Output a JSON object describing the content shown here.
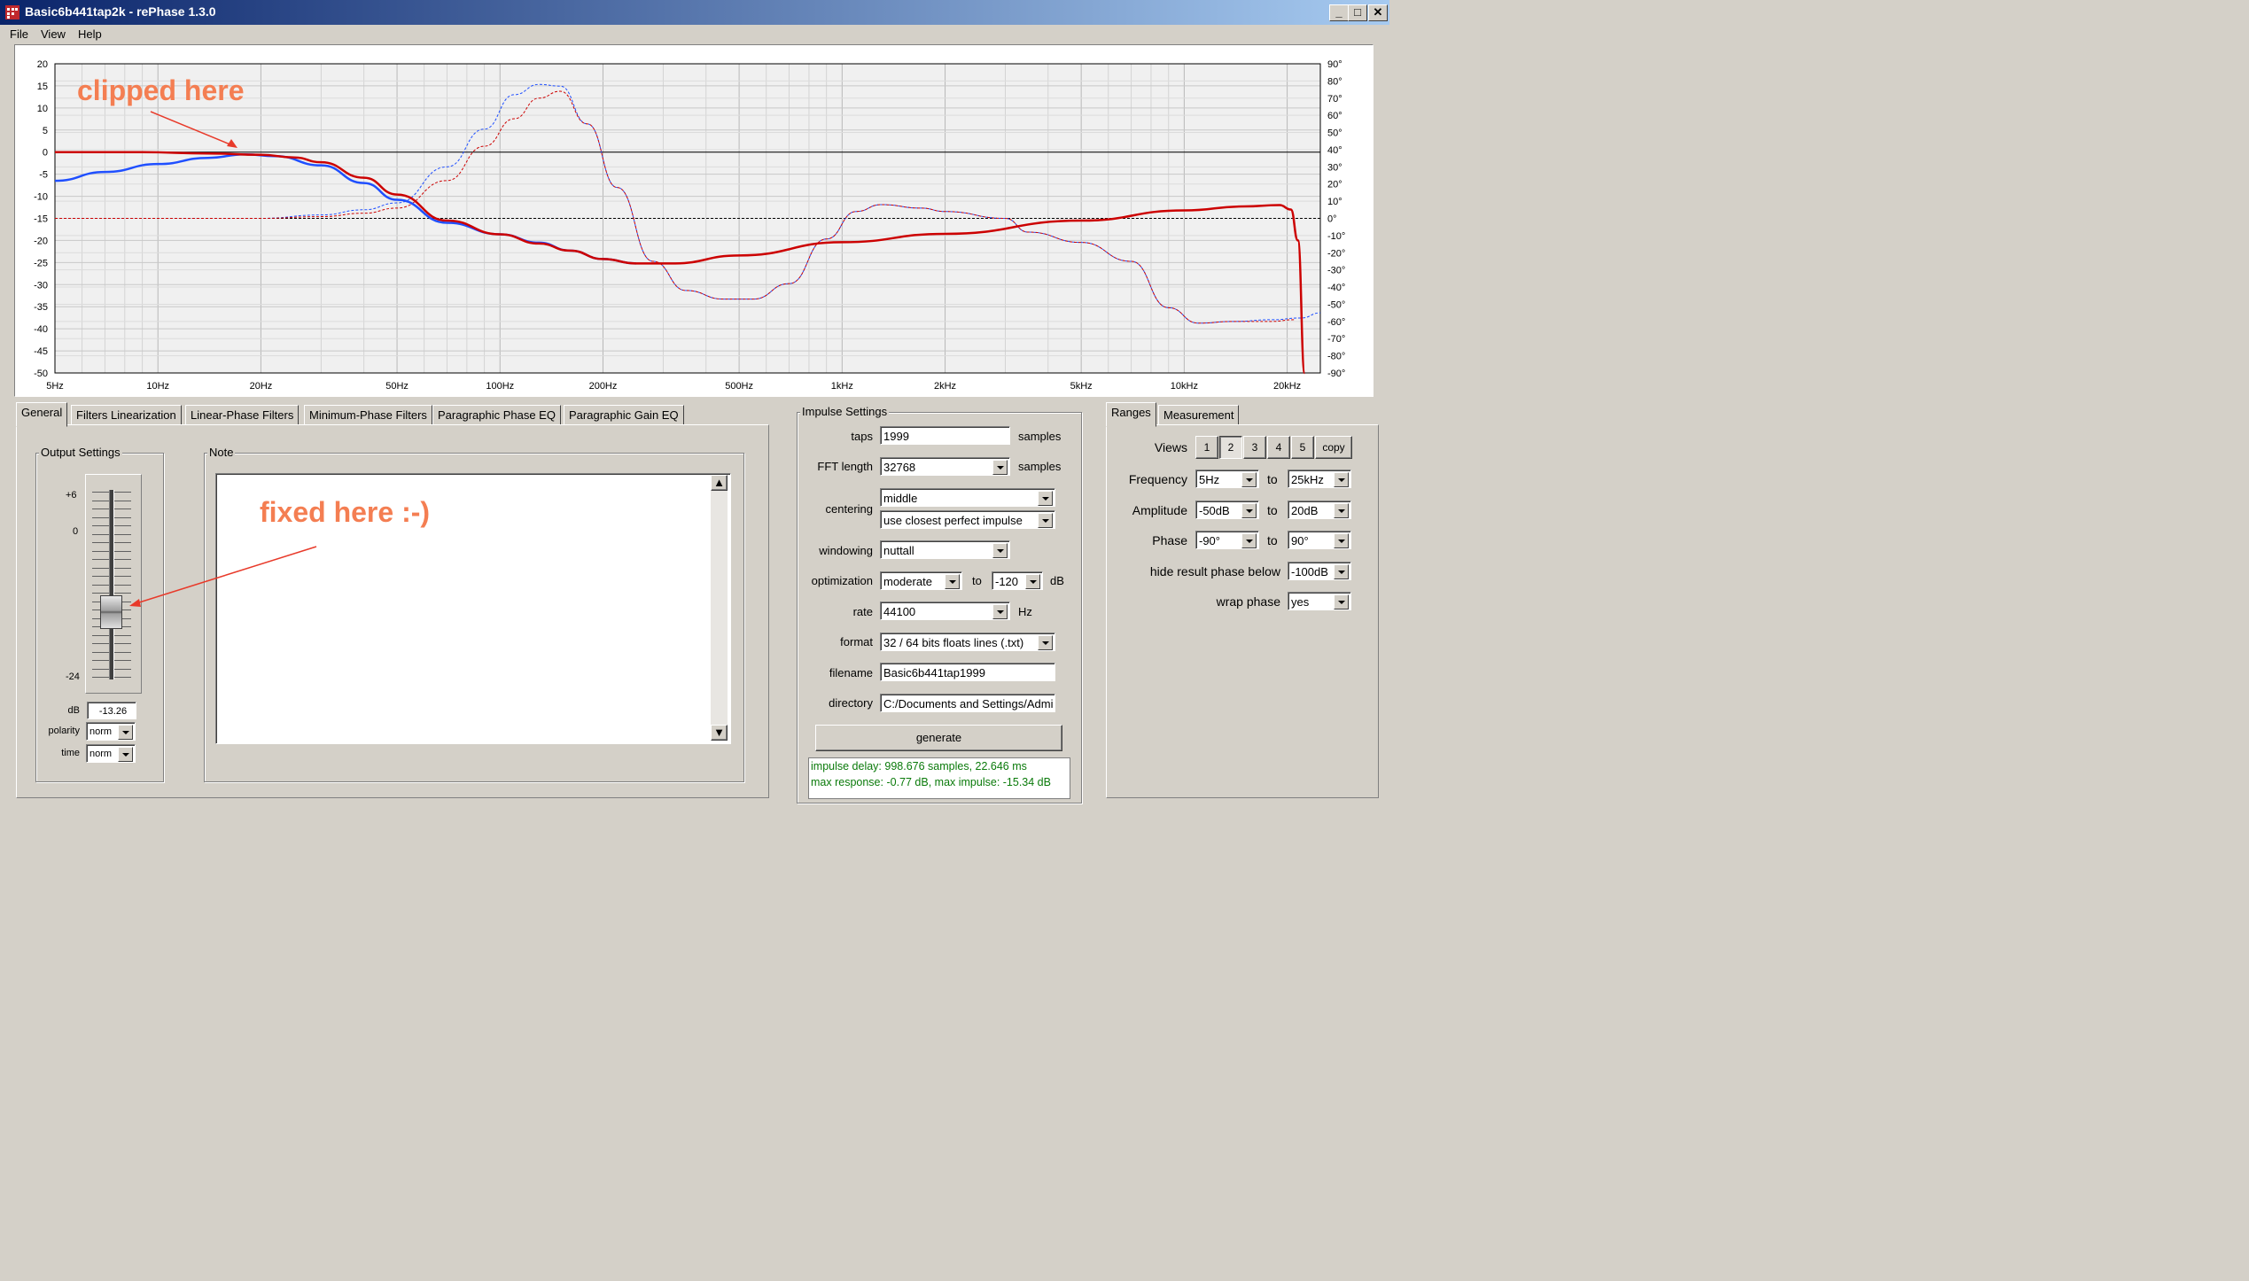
{
  "window": {
    "title": "Basic6b441tap2k  -  rePhase 1.3.0",
    "btn_min": "_",
    "btn_max": "□",
    "btn_close": "✕"
  },
  "menu": [
    "File",
    "View",
    "Help"
  ],
  "chart_data": {
    "type": "line",
    "x_scale": "log",
    "xlim": [
      5,
      25000
    ],
    "ylim_left": [
      -50,
      20
    ],
    "ylim_right": [
      -90,
      90
    ],
    "grid": true,
    "x_ticks": [
      {
        "v": 5,
        "label": "5Hz"
      },
      {
        "v": 10,
        "label": "10Hz"
      },
      {
        "v": 20,
        "label": "20Hz"
      },
      {
        "v": 50,
        "label": "50Hz"
      },
      {
        "v": 100,
        "label": "100Hz"
      },
      {
        "v": 200,
        "label": "200Hz"
      },
      {
        "v": 500,
        "label": "500Hz"
      },
      {
        "v": 1000,
        "label": "1kHz"
      },
      {
        "v": 2000,
        "label": "2kHz"
      },
      {
        "v": 5000,
        "label": "5kHz"
      },
      {
        "v": 10000,
        "label": "10kHz"
      },
      {
        "v": 20000,
        "label": "20kHz"
      }
    ],
    "y_left_ticks": [
      "20",
      "15",
      "10",
      "5",
      "0",
      "-5",
      "-10",
      "-15",
      "-20",
      "-25",
      "-30",
      "-35",
      "-40",
      "-45",
      "-50"
    ],
    "y_right_ticks": [
      "90°",
      "80°",
      "70°",
      "60°",
      "50°",
      "40°",
      "30°",
      "20°",
      "10°",
      "0°",
      "-10°",
      "-20°",
      "-30°",
      "-40°",
      "-50°",
      "-60°",
      "-70°",
      "-80°",
      "-90°"
    ],
    "colors": {
      "blue": "#1f4fff",
      "red": "#cc0000"
    },
    "series": [
      {
        "color": "blue",
        "style": "solid",
        "axis": "left",
        "points": [
          [
            5,
            -6.5
          ],
          [
            7,
            -4.5
          ],
          [
            10,
            -2.7
          ],
          [
            14,
            -1.3
          ],
          [
            18,
            -0.5
          ],
          [
            22,
            -0.9
          ],
          [
            30,
            -3
          ],
          [
            40,
            -7
          ],
          [
            50,
            -10.8
          ],
          [
            70,
            -16
          ],
          [
            100,
            -18.6
          ],
          [
            130,
            -20.5
          ],
          [
            160,
            -22.3
          ],
          [
            200,
            -24.2
          ],
          [
            250,
            -25.2
          ]
        ]
      },
      {
        "color": "red",
        "style": "solid",
        "axis": "left",
        "points": [
          [
            5,
            0
          ],
          [
            9,
            0
          ],
          [
            14,
            -0.3
          ],
          [
            20,
            -0.6
          ],
          [
            25,
            -1.2
          ],
          [
            30,
            -2.3
          ],
          [
            40,
            -5.8
          ],
          [
            50,
            -9.6
          ],
          [
            70,
            -15.5
          ],
          [
            100,
            -18.6
          ],
          [
            130,
            -20.7
          ],
          [
            160,
            -22.3
          ],
          [
            200,
            -24.2
          ],
          [
            250,
            -25.2
          ],
          [
            320,
            -25.2
          ],
          [
            500,
            -23.4
          ],
          [
            1000,
            -20.4
          ],
          [
            2000,
            -18.5
          ],
          [
            5000,
            -15.5
          ],
          [
            10000,
            -13.2
          ],
          [
            15000,
            -12.3
          ],
          [
            19000,
            -12
          ],
          [
            20500,
            -13
          ],
          [
            21500,
            -20
          ],
          [
            22500,
            -50
          ]
        ]
      },
      {
        "color": "blue",
        "style": "dashed",
        "axis": "right",
        "points": [
          [
            5,
            0
          ],
          [
            20,
            0
          ],
          [
            30,
            2
          ],
          [
            40,
            5
          ],
          [
            50,
            9
          ],
          [
            70,
            30
          ],
          [
            90,
            52
          ],
          [
            110,
            72
          ],
          [
            130,
            78
          ],
          [
            150,
            77
          ],
          [
            180,
            55
          ],
          [
            220,
            18
          ],
          [
            280,
            -25
          ],
          [
            350,
            -42
          ],
          [
            450,
            -47
          ],
          [
            550,
            -47
          ],
          [
            700,
            -38
          ],
          [
            900,
            -12
          ],
          [
            1100,
            4
          ],
          [
            1300,
            8
          ],
          [
            1700,
            6
          ],
          [
            2000,
            4
          ],
          [
            3000,
            0
          ],
          [
            3500,
            -8
          ],
          [
            5000,
            -14
          ],
          [
            7000,
            -25
          ],
          [
            9000,
            -52
          ],
          [
            11000,
            -61
          ],
          [
            14000,
            -60
          ],
          [
            18000,
            -59
          ],
          [
            22000,
            -58
          ],
          [
            25000,
            -55
          ]
        ]
      },
      {
        "color": "red",
        "style": "dashed",
        "axis": "right",
        "points": [
          [
            5,
            0
          ],
          [
            20,
            0
          ],
          [
            30,
            1
          ],
          [
            40,
            3
          ],
          [
            50,
            6
          ],
          [
            70,
            22
          ],
          [
            90,
            42
          ],
          [
            110,
            58
          ],
          [
            130,
            70
          ],
          [
            150,
            74
          ],
          [
            180,
            55
          ],
          [
            220,
            18
          ],
          [
            280,
            -25
          ],
          [
            350,
            -42
          ],
          [
            450,
            -47
          ],
          [
            550,
            -47
          ],
          [
            700,
            -38
          ],
          [
            900,
            -12
          ],
          [
            1100,
            4
          ],
          [
            1300,
            8
          ],
          [
            1700,
            6
          ],
          [
            2000,
            4
          ],
          [
            3000,
            0
          ],
          [
            3500,
            -8
          ],
          [
            5000,
            -14
          ],
          [
            7000,
            -25
          ],
          [
            9000,
            -52
          ],
          [
            11000,
            -61
          ],
          [
            14000,
            -60
          ],
          [
            18000,
            -60
          ],
          [
            21000,
            -59
          ]
        ]
      }
    ]
  },
  "annotations": {
    "clipped": "clipped here",
    "fixed": "fixed here :-)"
  },
  "tabs": [
    "General",
    "Filters Linearization",
    "Linear-Phase Filters",
    "Minimum-Phase Filters",
    "Paragraphic Phase EQ",
    "Paragraphic Gain EQ"
  ],
  "output_settings": {
    "title": "Output Settings",
    "scale_top": "+6",
    "scale_mid": "0",
    "scale_bottom": "-24",
    "level_db": -13.26,
    "db_label": "dB",
    "db_value": "-13.26",
    "polarity_label": "polarity",
    "polarity_value": "norm",
    "time_label": "time",
    "time_value": "norm"
  },
  "note": {
    "title": "Note",
    "text": ""
  },
  "impulse": {
    "title": "Impulse Settings",
    "taps_label": "taps",
    "taps_value": "1999",
    "taps_unit": "samples",
    "fft_label": "FFT length",
    "fft_value": "32768",
    "fft_unit": "samples",
    "centering_label": "centering",
    "centering_value": "middle",
    "centering_value2": "use closest perfect impulse",
    "windowing_label": "windowing",
    "windowing_value": "nuttall",
    "optimization_label": "optimization",
    "optimization_value": "moderate",
    "optimization_to": "to",
    "optimization_db": "-120",
    "optimization_unit": "dB",
    "rate_label": "rate",
    "rate_value": "44100",
    "rate_unit": "Hz",
    "format_label": "format",
    "format_value": "32 / 64 bits floats lines (.txt)",
    "filename_label": "filename",
    "filename_value": "Basic6b441tap1999",
    "directory_label": "directory",
    "directory_value": "C:/Documents and Settings/Admi",
    "generate_label": "generate",
    "status1": "impulse delay: 998.676 samples, 22.646 ms",
    "status2": "max response: -0.77 dB, max impulse: -15.34 dB",
    "status_color": "#0a7a0a"
  },
  "ranges": {
    "tabs": [
      "Ranges",
      "Measurement"
    ],
    "views_label": "Views",
    "views": [
      "1",
      "2",
      "3",
      "4",
      "5",
      "copy"
    ],
    "views_selected": "2",
    "frequency_label": "Frequency",
    "frequency_from": "5Hz",
    "frequency_to": "25kHz",
    "amplitude_label": "Amplitude",
    "amplitude_from": "-50dB",
    "amplitude_to": "20dB",
    "phase_label": "Phase",
    "phase_from": "-90°",
    "phase_to": "90°",
    "to": "to",
    "hide_label": "hide result phase below",
    "hide_value": "-100dB",
    "wrap_label": "wrap phase",
    "wrap_value": "yes"
  }
}
